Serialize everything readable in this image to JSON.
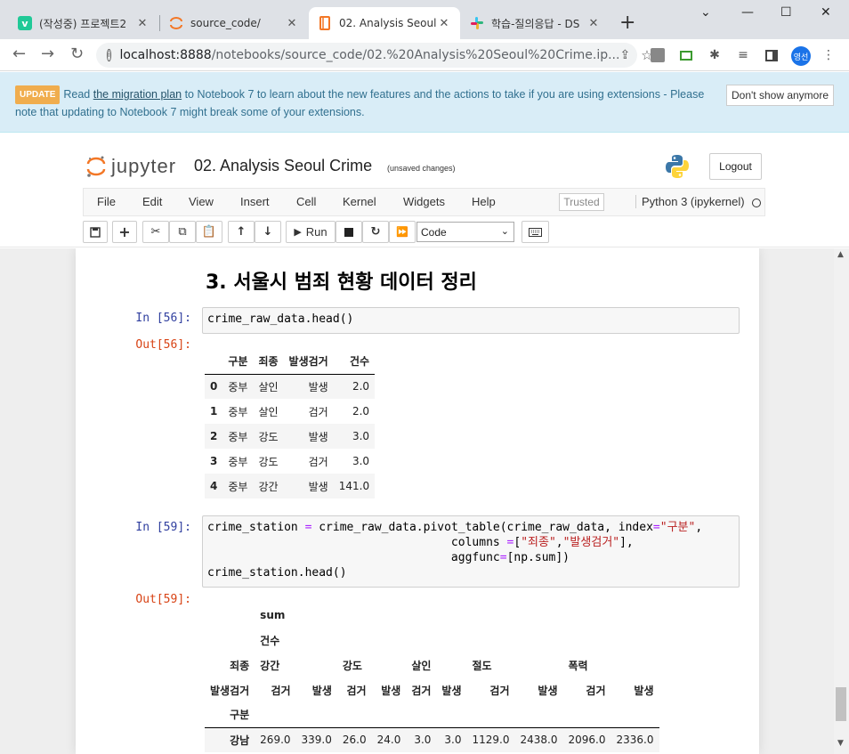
{
  "browser": {
    "tabs": [
      {
        "title": "(작성중) 프로젝트2",
        "icon": "velog-icon"
      },
      {
        "title": "source_code/",
        "icon": "jupyter-icon"
      },
      {
        "title": "02. Analysis Seoul",
        "icon": "notebook-icon"
      },
      {
        "title": "학습-질의응답 - DS",
        "icon": "slack-icon"
      }
    ],
    "url_host": "localhost:8888",
    "url_path": "/notebooks/source_code/02.%20Analysis%20Seoul%20Crime.ip...",
    "profile": "영선"
  },
  "banner": {
    "badge": "UPDATE",
    "pre": "Read ",
    "link": "the migration plan",
    "post": " to Notebook 7 to learn about the new features and the actions to take if you are using extensions - Please note that updating to Notebook 7 might break some of your extensions.",
    "dismiss": "Don't show anymore"
  },
  "jupyter": {
    "logo": "jupyter",
    "notebook_name": "02. Analysis Seoul Crime",
    "autosave": "(unsaved changes)",
    "logout": "Logout",
    "menu": [
      "File",
      "Edit",
      "View",
      "Insert",
      "Cell",
      "Kernel",
      "Widgets",
      "Help"
    ],
    "trusted": "Trusted",
    "kernel": "Python 3 (ipykernel)",
    "run_label": "Run",
    "cell_type": "Code"
  },
  "notebook": {
    "heading": "3. 서울시 범죄 현황 데이터 정리",
    "in56": "In [56]:",
    "code56": "crime_raw_data.head()",
    "out56": "Out[56]:",
    "table56": {
      "columns": [
        "구분",
        "죄종",
        "발생검거",
        "건수"
      ],
      "rows": [
        [
          "0",
          "중부",
          "살인",
          "발생",
          "2.0"
        ],
        [
          "1",
          "중부",
          "살인",
          "검거",
          "2.0"
        ],
        [
          "2",
          "중부",
          "강도",
          "발생",
          "3.0"
        ],
        [
          "3",
          "중부",
          "강도",
          "검거",
          "3.0"
        ],
        [
          "4",
          "중부",
          "강간",
          "발생",
          "141.0"
        ]
      ]
    },
    "in59": "In [59]:",
    "code59": {
      "l1a": "crime_station ",
      "l1eq": "=",
      "l1b": " crime_raw_data.pivot_table(crime_raw_data, index",
      "l1eq2": "=",
      "l1s": "\"구분\"",
      "l1c": ",",
      "l2a": "                                   columns ",
      "l2eq": "=",
      "l2b": "[",
      "l2s1": "\"죄종\"",
      "l2c": ",",
      "l2s2": "\"발생검거\"",
      "l2d": "],",
      "l3a": "                                   aggfunc",
      "l3eq": "=",
      "l3b": "[np.sum])",
      "l4": "crime_station.head()"
    },
    "out59": "Out[59]:",
    "table59": {
      "h1": "sum",
      "h2": "건수",
      "h3_label": "죄종",
      "crimes": [
        "강간",
        "강도",
        "살인",
        "절도",
        "폭력"
      ],
      "h4_label": "발생검거",
      "sub": [
        "검거",
        "발생",
        "검거",
        "발생",
        "검거",
        "발생",
        "검거",
        "발생",
        "검거",
        "발생"
      ],
      "index_name": "구분",
      "row_label": "강남",
      "row_values": [
        "269.0",
        "339.0",
        "26.0",
        "24.0",
        "3.0",
        "3.0",
        "1129.0",
        "2438.0",
        "2096.0",
        "2336.0"
      ]
    }
  }
}
